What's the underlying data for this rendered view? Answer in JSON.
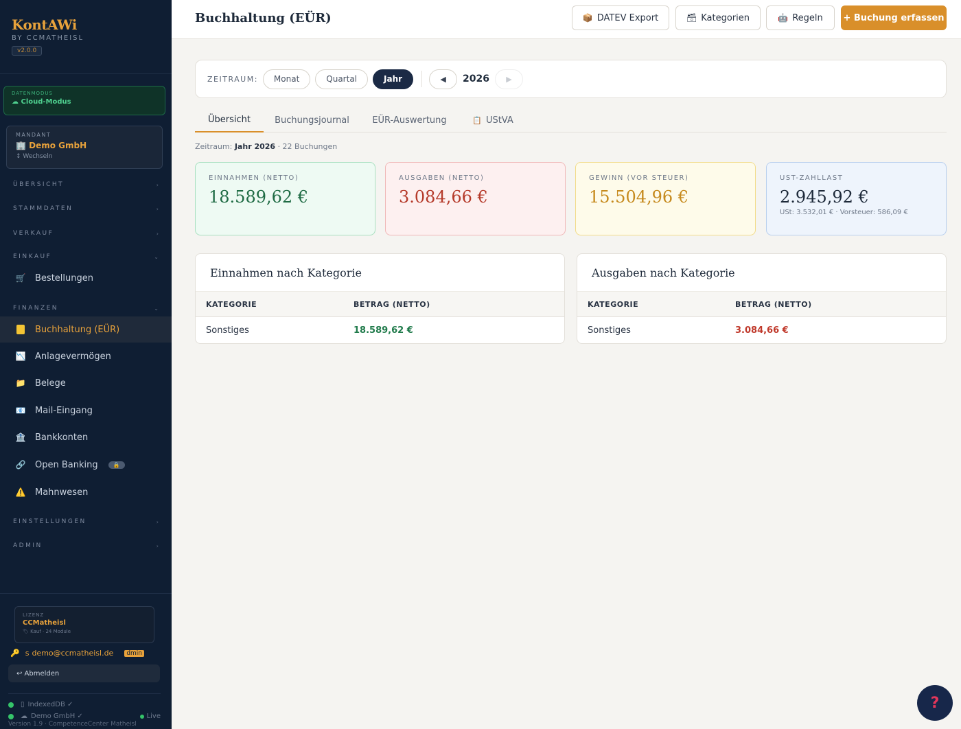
{
  "sidebar": {
    "brand": {
      "name": "KontAWi",
      "by": "BY CCMATHEISL",
      "version": "v2.0.0"
    },
    "datenmodus": {
      "label": "DATENMODUS",
      "value": "☁ Cloud-Modus"
    },
    "mandant": {
      "label": "MANDANT",
      "value": "Demo GmbH",
      "switch": "↕ Wechseln"
    },
    "sections": {
      "uebersicht": "ÜBERSICHT",
      "stammdaten": "STAMMDATEN",
      "verkauf": "VERKAUF",
      "einkauf": "EINKAUF",
      "finanzen": "FINANZEN",
      "einstellungen": "EINSTELLUNGEN",
      "admin": "ADMIN"
    },
    "items": {
      "bestellungen": "Bestellungen",
      "buchhaltung": "Buchhaltung (EÜR)",
      "anlagevermoegen": "Anlagevermögen",
      "belege": "Belege",
      "mail_eingang": "Mail-Eingang",
      "bankkonten": "Bankkonten",
      "open_banking": "Open Banking",
      "mahnwesen": "Mahnwesen"
    },
    "license": {
      "label": "LIZENZ",
      "value": "CCMatheisl",
      "sub": "Kauf · 24 Module"
    },
    "user": {
      "prefix": "s",
      "email": "demo@ccmatheisl.de",
      "role": "dmin"
    },
    "logout": "↩ Abmelden",
    "status": {
      "indexeddb": "IndexedDB ✓",
      "demo": "Demo GmbH ✓",
      "live": "Live"
    },
    "version_line": "Version 1.9 · CompetenceCenter Matheisl"
  },
  "header": {
    "title": "Buchhaltung (EÜR)",
    "buttons": {
      "datev": "DATEV Export",
      "kategorien": "Kategorien",
      "regeln": "Regeln",
      "buchung": "+ Buchung erfassen"
    }
  },
  "period": {
    "label": "ZEITRAUM:",
    "options": [
      "Monat",
      "Quartal",
      "Jahr"
    ],
    "selected": "Jahr",
    "prev": "◀",
    "next": "▶",
    "year": "2026"
  },
  "tabs": [
    "Übersicht",
    "Buchungsjournal",
    "EÜR-Auswertung",
    "UStVA"
  ],
  "meta": {
    "prefix": "Zeitraum:",
    "period": "Jahr 2026",
    "suffix": "· 22 Buchungen"
  },
  "kpis": {
    "einnahmen": {
      "label": "EINNAHMEN (NETTO)",
      "value": "18.589,62 €"
    },
    "ausgaben": {
      "label": "AUSGABEN (NETTO)",
      "value": "3.084,66 €"
    },
    "gewinn": {
      "label": "GEWINN (VOR STEUER)",
      "value": "15.504,96 €"
    },
    "ust": {
      "label": "UST-ZAHLLAST",
      "value": "2.945,92 €",
      "sub": "USt: 3.532,01 € · Vorsteuer: 586,09 €"
    }
  },
  "einnahmen_table": {
    "title": "Einnahmen nach Kategorie",
    "columns": [
      "KATEGORIE",
      "BETRAG (NETTO)"
    ],
    "rows": [
      {
        "kategorie": "Sonstiges",
        "betrag": "18.589,62 €"
      }
    ]
  },
  "ausgaben_table": {
    "title": "Ausgaben nach Kategorie",
    "columns": [
      "KATEGORIE",
      "BETRAG (NETTO)"
    ],
    "rows": [
      {
        "kategorie": "Sonstiges",
        "betrag": "3.084,66 €"
      }
    ]
  },
  "help": "?",
  "colors": {
    "accent": "#d98f2a",
    "sidebar": "#0f1e33",
    "income": "#1f7a4a",
    "expense": "#c0392b"
  }
}
